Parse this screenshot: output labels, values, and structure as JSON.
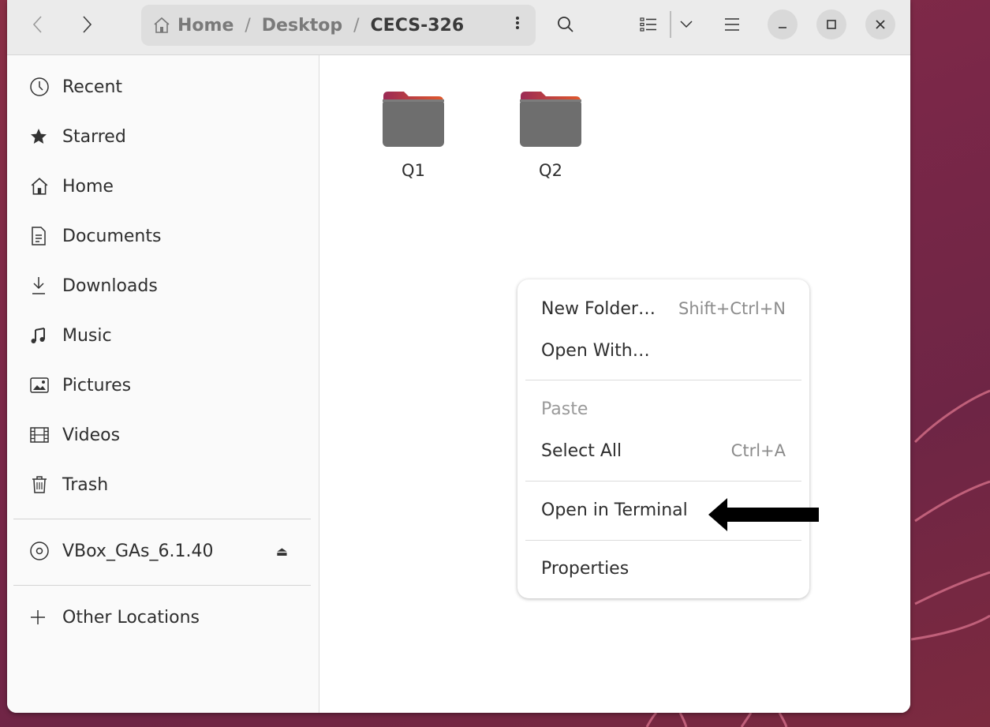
{
  "toolbar": {
    "back_icon": "chevron-left-icon",
    "forward_icon": "chevron-right-icon",
    "search_icon": "search-icon",
    "view_icon": "list-view-icon",
    "menu_icon": "hamburger-icon"
  },
  "pathbar": {
    "segments": [
      "Home",
      "Desktop",
      "CECS-326"
    ],
    "separator": "/"
  },
  "sidebar": {
    "items": [
      {
        "label": "Recent",
        "icon": "clock-icon"
      },
      {
        "label": "Starred",
        "icon": "star-icon"
      },
      {
        "label": "Home",
        "icon": "home-icon"
      },
      {
        "label": "Documents",
        "icon": "document-icon"
      },
      {
        "label": "Downloads",
        "icon": "download-icon"
      },
      {
        "label": "Music",
        "icon": "music-icon"
      },
      {
        "label": "Pictures",
        "icon": "picture-icon"
      },
      {
        "label": "Videos",
        "icon": "film-icon"
      },
      {
        "label": "Trash",
        "icon": "trash-icon"
      }
    ],
    "device": {
      "label": "VBox_GAs_6.1.40",
      "icon": "disc-icon",
      "eject_symbol": "⏏"
    },
    "other_locations": {
      "label": "Other Locations",
      "icon": "plus-icon",
      "symbol": "+"
    }
  },
  "content": {
    "folders": [
      {
        "name": "Q1",
        "icon": "folder-icon"
      },
      {
        "name": "Q2",
        "icon": "folder-icon"
      }
    ]
  },
  "context_menu": {
    "items": [
      {
        "label": "New Folder…",
        "accel": "Shift+Ctrl+N",
        "enabled": true
      },
      {
        "label": "Open With…",
        "accel": "",
        "enabled": true
      },
      {
        "label": "Paste",
        "accel": "",
        "enabled": false
      },
      {
        "label": "Select All",
        "accel": "Ctrl+A",
        "enabled": true
      },
      {
        "label": "Open in Terminal",
        "accel": "",
        "enabled": true
      },
      {
        "label": "Properties",
        "accel": "",
        "enabled": true
      }
    ]
  },
  "colors": {
    "desktop_bg": "#7a2748",
    "folder_tab": "#c4314b",
    "folder_body": "#6b6b6b",
    "arrow": "#000000"
  }
}
